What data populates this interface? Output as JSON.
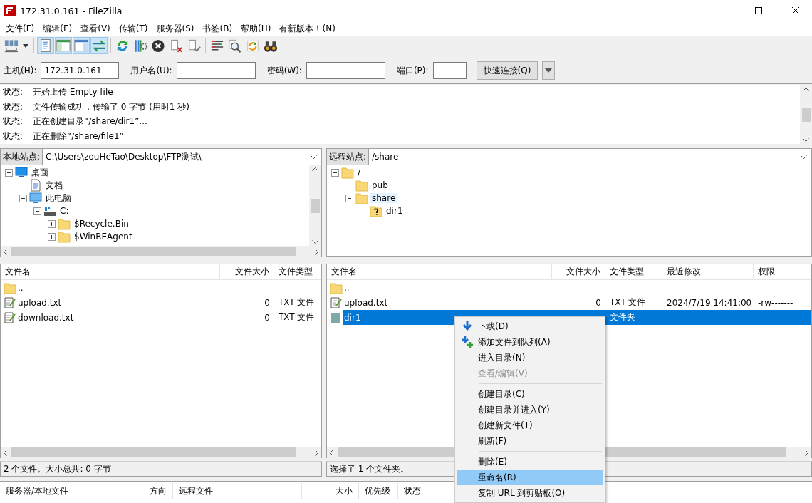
{
  "window": {
    "title": "172.31.0.161 - FileZilla"
  },
  "menu": [
    "文件(F)",
    "编辑(E)",
    "查看(V)",
    "传输(T)",
    "服务器(S)",
    "书签(B)",
    "帮助(H)",
    "有新版本！(N)"
  ],
  "toolbar": [
    {
      "kind": "sites",
      "pressed": false
    },
    {
      "kind": "caret",
      "pressed": false
    },
    {
      "kind": "sep"
    },
    {
      "kind": "log",
      "pressed": true
    },
    {
      "kind": "localtree",
      "pressed": true
    },
    {
      "kind": "remotetree",
      "pressed": true
    },
    {
      "kind": "queue",
      "pressed": true
    },
    {
      "kind": "sep"
    },
    {
      "kind": "refresh",
      "pressed": false
    },
    {
      "kind": "process",
      "pressed": false
    },
    {
      "kind": "cancel",
      "pressed": false
    },
    {
      "kind": "disconnect",
      "pressed": false
    },
    {
      "kind": "reconnect",
      "pressed": false
    },
    {
      "kind": "sep"
    },
    {
      "kind": "filter",
      "pressed": false
    },
    {
      "kind": "compare",
      "pressed": false
    },
    {
      "kind": "sync",
      "pressed": false
    },
    {
      "kind": "search",
      "pressed": false
    }
  ],
  "quickconnect": {
    "host_label": "主机(H):",
    "host": "172.31.0.161",
    "user_label": "用户名(U):",
    "password_label": "密码(W):",
    "port_label": "端口(P):",
    "button": "快速连接(Q)"
  },
  "log": [
    {
      "label": "状态:",
      "text": "开始上传 Empty file"
    },
    {
      "label": "状态:",
      "text": "文件传输成功，传输了 0 字节 (用时1 秒)"
    },
    {
      "label": "状态:",
      "text": "正在创建目录“/share/dir1”..."
    },
    {
      "label": "状态:",
      "text": "正在删除“/share/file1”"
    }
  ],
  "local": {
    "site_label": "本地站点:",
    "path": "C:\\Users\\zouHeTao\\Desktop\\FTP测试\\",
    "tree": [
      {
        "label": "桌面",
        "kind": "desktop",
        "expanded": true,
        "selected": false,
        "children": [
          {
            "label": "文档",
            "kind": "document",
            "selected": false
          },
          {
            "label": "此电脑",
            "kind": "computer",
            "expanded": true,
            "selected": false,
            "children": [
              {
                "label": "C:",
                "kind": "drive",
                "expanded": true,
                "selected": false,
                "children": [
                  {
                    "label": "$Recycle.Bin",
                    "kind": "folder",
                    "expanded": false,
                    "selected": false
                  },
                  {
                    "label": "$WinREAgent",
                    "kind": "folder",
                    "expanded": false,
                    "selected": false
                  }
                ]
              }
            ]
          }
        ]
      }
    ],
    "columns": [
      "文件名",
      "文件大小",
      "文件类型"
    ],
    "rows": [
      {
        "kind": "folder",
        "cells": [
          ".."
        ],
        "selected": false
      },
      {
        "kind": "text",
        "cells": [
          "upload.txt",
          "0",
          "TXT 文件"
        ],
        "selected": false
      },
      {
        "kind": "text",
        "cells": [
          "download.txt",
          "0",
          "TXT 文件"
        ],
        "selected": false
      }
    ],
    "status": "2 个文件。大小总共: 0 字节"
  },
  "remote": {
    "site_label": "远程站点:",
    "path": "/share",
    "tree": [
      {
        "label": "/",
        "kind": "folder",
        "expanded": true,
        "selected": false,
        "children": [
          {
            "label": "pub",
            "kind": "folder",
            "selected": false
          },
          {
            "label": "share",
            "kind": "folder",
            "expanded": true,
            "selected": true,
            "children": [
              {
                "label": "dir1",
                "kind": "unknown",
                "selected": false
              }
            ]
          }
        ]
      }
    ],
    "columns": [
      "文件名",
      "文件大小",
      "文件类型",
      "最近修改",
      "权限"
    ],
    "rows": [
      {
        "kind": "folder",
        "cells": [
          ".."
        ],
        "selected": false
      },
      {
        "kind": "text",
        "cells": [
          "upload.txt",
          "0",
          "TXT 文件",
          "2024/7/19 14:41:00",
          "-rw-------"
        ],
        "selected": false
      },
      {
        "kind": "plain",
        "cells": [
          "dir1",
          "",
          "文件夹"
        ],
        "selected": true
      }
    ],
    "status": "选择了 1 个文件夹。"
  },
  "context_menu": [
    {
      "kind": "download",
      "label": "下载(D)",
      "disabled": false,
      "selected": false
    },
    {
      "kind": "enqueue",
      "label": "添加文件到队列(A)",
      "disabled": false,
      "selected": false
    },
    {
      "kind": "item",
      "label": "进入目录(N)",
      "disabled": false,
      "selected": false
    },
    {
      "kind": "item",
      "label": "查看/编辑(V)",
      "disabled": true,
      "selected": false
    },
    {
      "kind": "separator"
    },
    {
      "kind": "item",
      "label": "创建目录(C)",
      "disabled": false,
      "selected": false
    },
    {
      "kind": "item",
      "label": "创建目录并进入(Y)",
      "disabled": false,
      "selected": false
    },
    {
      "kind": "item",
      "label": "创建新文件(T)",
      "disabled": false,
      "selected": false
    },
    {
      "kind": "item",
      "label": "刷新(F)",
      "disabled": false,
      "selected": false
    },
    {
      "kind": "separator"
    },
    {
      "kind": "item",
      "label": "删除(E)",
      "disabled": false,
      "selected": false
    },
    {
      "kind": "item",
      "label": "重命名(R)",
      "disabled": false,
      "selected": true
    },
    {
      "kind": "item",
      "label": "复制 URL 到剪贴板(O)",
      "disabled": false,
      "selected": false
    }
  ],
  "queue": {
    "columns": [
      "服务器/本地文件",
      "方向",
      "远程文件",
      "大小",
      "优先级",
      "状态"
    ]
  }
}
